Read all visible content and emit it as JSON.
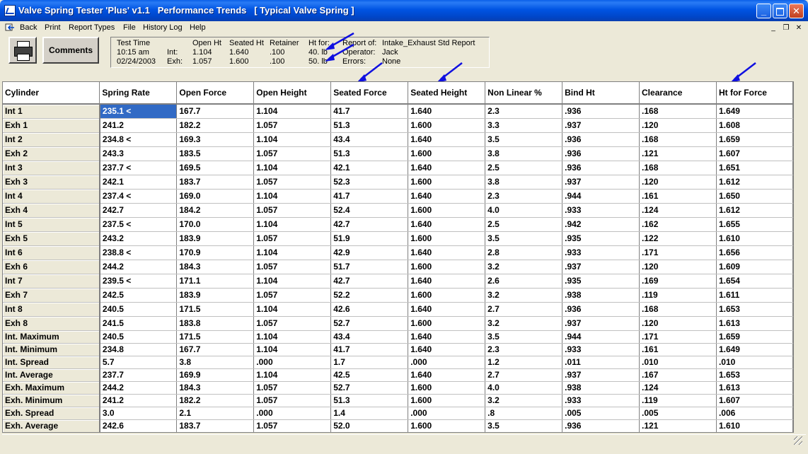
{
  "window": {
    "title": "Valve Spring Tester 'Plus' v1.1   Performance Trends   [ Typical Valve Spring ]",
    "minimize": "_",
    "maximize": "□",
    "close": "✕",
    "icons": {
      "app": "valve-spring-app-icon"
    }
  },
  "menu": {
    "items": [
      "Back",
      "Print",
      "Report Types",
      "File",
      "History Log",
      "Help"
    ],
    "mdi": [
      "_",
      "❐",
      "✕"
    ],
    "icons": {
      "back": "back-icon"
    }
  },
  "toolbar": {
    "comments_label": "Comments",
    "icons": {
      "print": "printer-icon"
    }
  },
  "info": {
    "test_time_label": "Test Time",
    "time": "10:15 am",
    "date": "02/24/2003",
    "int_label": "Int:",
    "exh_label": "Exh:",
    "open_ht_label": "Open Ht",
    "seated_ht_label": "Seated Ht",
    "retainer_label": "Retainer",
    "ht_for_label": "Ht for:",
    "int_open_ht": "1.104",
    "int_seated_ht": "1.640",
    "int_retainer": ".100",
    "int_ht_for": "40. lb",
    "exh_open_ht": "1.057",
    "exh_seated_ht": "1.600",
    "exh_retainer": ".100",
    "exh_ht_for": "50. lb",
    "report_of_label": "Report of:",
    "report_of": "Intake_Exhaust Std Report",
    "operator_label": "Operator:",
    "operator": "Jack",
    "errors_label": "Errors:",
    "errors": "None"
  },
  "annotation_color": "#1010e0",
  "table": {
    "columns": [
      "Cylinder",
      "Spring Rate",
      "Open Force",
      "Open Height",
      "Seated Force",
      "Seated Height",
      "Non Linear %",
      "Bind Ht",
      "Clearance",
      "Ht for Force"
    ],
    "rows": [
      [
        "Int 1",
        "235.1 <",
        "167.7",
        "1.104",
        "41.7",
        "1.640",
        "2.3",
        ".936",
        ".168",
        "1.649"
      ],
      [
        "Exh 1",
        "241.2",
        "182.2",
        "1.057",
        "51.3",
        "1.600",
        "3.3",
        ".937",
        ".120",
        "1.608"
      ],
      [
        "Int 2",
        "234.8 <",
        "169.3",
        "1.104",
        "43.4",
        "1.640",
        "3.5",
        ".936",
        ".168",
        "1.659"
      ],
      [
        "Exh 2",
        "243.3",
        "183.5",
        "1.057",
        "51.3",
        "1.600",
        "3.8",
        ".936",
        ".121",
        "1.607"
      ],
      [
        "Int 3",
        "237.7 <",
        "169.5",
        "1.104",
        "42.1",
        "1.640",
        "2.5",
        ".936",
        ".168",
        "1.651"
      ],
      [
        "Exh 3",
        "242.1",
        "183.7",
        "1.057",
        "52.3",
        "1.600",
        "3.8",
        ".937",
        ".120",
        "1.612"
      ],
      [
        "Int 4",
        "237.4 <",
        "169.0",
        "1.104",
        "41.7",
        "1.640",
        "2.3",
        ".944",
        ".161",
        "1.650"
      ],
      [
        "Exh 4",
        "242.7",
        "184.2",
        "1.057",
        "52.4",
        "1.600",
        "4.0",
        ".933",
        ".124",
        "1.612"
      ],
      [
        "Int 5",
        "237.5 <",
        "170.0",
        "1.104",
        "42.7",
        "1.640",
        "2.5",
        ".942",
        ".162",
        "1.655"
      ],
      [
        "Exh 5",
        "243.2",
        "183.9",
        "1.057",
        "51.9",
        "1.600",
        "3.5",
        ".935",
        ".122",
        "1.610"
      ],
      [
        "Int 6",
        "238.8 <",
        "170.9",
        "1.104",
        "42.9",
        "1.640",
        "2.8",
        ".933",
        ".171",
        "1.656"
      ],
      [
        "Exh 6",
        "244.2",
        "184.3",
        "1.057",
        "51.7",
        "1.600",
        "3.2",
        ".937",
        ".120",
        "1.609"
      ],
      [
        "Int 7",
        "239.5 <",
        "171.1",
        "1.104",
        "42.7",
        "1.640",
        "2.6",
        ".935",
        ".169",
        "1.654"
      ],
      [
        "Exh 7",
        "242.5",
        "183.9",
        "1.057",
        "52.2",
        "1.600",
        "3.2",
        ".938",
        ".119",
        "1.611"
      ],
      [
        "Int 8",
        "240.5",
        "171.5",
        "1.104",
        "42.6",
        "1.640",
        "2.7",
        ".936",
        ".168",
        "1.653"
      ],
      [
        "Exh 8",
        "241.5",
        "183.8",
        "1.057",
        "52.7",
        "1.600",
        "3.2",
        ".937",
        ".120",
        "1.613"
      ]
    ],
    "summary": [
      [
        "Int. Maximum",
        "240.5",
        "171.5",
        "1.104",
        "43.4",
        "1.640",
        "3.5",
        ".944",
        ".171",
        "1.659"
      ],
      [
        "Int. Minimum",
        "234.8",
        "167.7",
        "1.104",
        "41.7",
        "1.640",
        "2.3",
        ".933",
        ".161",
        "1.649"
      ],
      [
        "Int. Spread",
        "5.7",
        "3.8",
        ".000",
        "1.7",
        ".000",
        "1.2",
        ".011",
        ".010",
        ".010"
      ],
      [
        "Int. Average",
        "237.7",
        "169.9",
        "1.104",
        "42.5",
        "1.640",
        "2.7",
        ".937",
        ".167",
        "1.653"
      ],
      [
        "Exh. Maximum",
        "244.2",
        "184.3",
        "1.057",
        "52.7",
        "1.600",
        "4.0",
        ".938",
        ".124",
        "1.613"
      ],
      [
        "Exh. Minimum",
        "241.2",
        "182.2",
        "1.057",
        "51.3",
        "1.600",
        "3.2",
        ".933",
        ".119",
        "1.607"
      ],
      [
        "Exh. Spread",
        "3.0",
        "2.1",
        ".000",
        "1.4",
        ".000",
        ".8",
        ".005",
        ".005",
        ".006"
      ],
      [
        "Exh. Average",
        "242.6",
        "183.7",
        "1.057",
        "52.0",
        "1.600",
        "3.5",
        ".936",
        ".121",
        "1.610"
      ]
    ]
  }
}
